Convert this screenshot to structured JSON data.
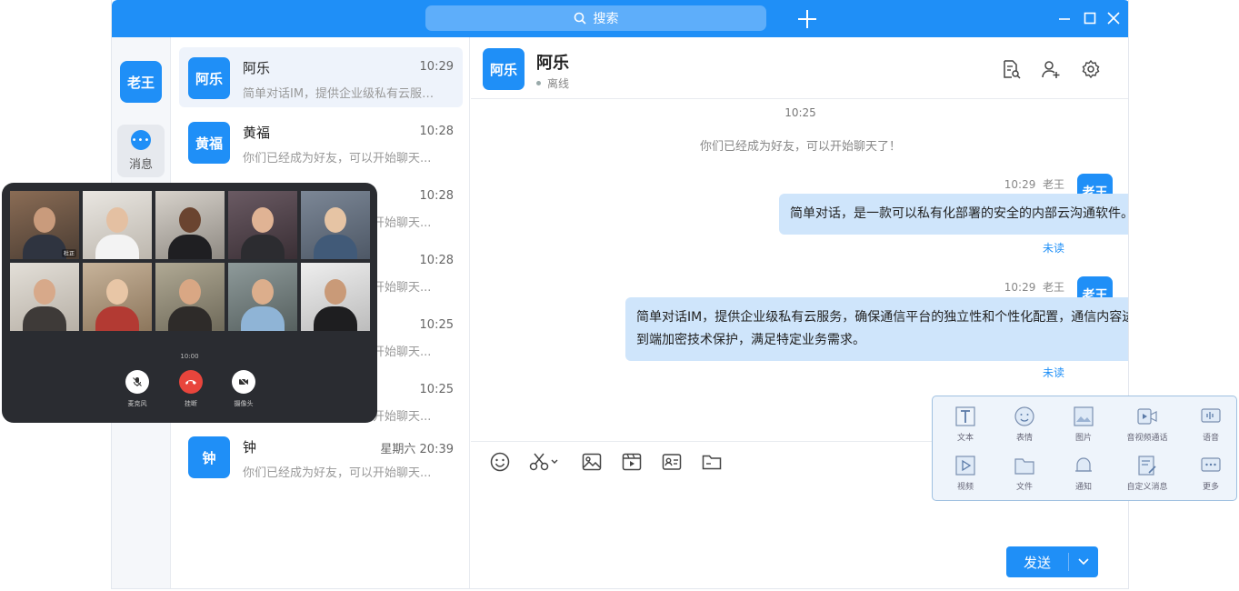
{
  "titlebar": {
    "search_placeholder": "搜索"
  },
  "rail": {
    "avatar": "老王",
    "messages_label": "消息"
  },
  "conversations": [
    {
      "avatar": "阿乐",
      "name": "阿乐",
      "time": "10:29",
      "preview": "简单对话IM，提供企业级私有云服务...",
      "active": true
    },
    {
      "avatar": "黄福",
      "name": "黄福",
      "time": "10:28",
      "preview": "你们已经成为好友，可以开始聊天..."
    },
    {
      "avatar": "",
      "name": "",
      "time": "10:28",
      "preview": "你们已经成为好友，可以开始聊天..."
    },
    {
      "avatar": "",
      "name": "",
      "time": "10:28",
      "preview": "你们已经成为好友，可以开始聊天..."
    },
    {
      "avatar": "",
      "name": "",
      "time": "10:25",
      "preview": "你们已经成为好友，可以开始聊天..."
    },
    {
      "avatar": "",
      "name": "",
      "time": "10:25",
      "preview": "你们已经成为好友，可以开始聊天..."
    },
    {
      "avatar": "钟",
      "name": "钟",
      "time": "星期六 20:39",
      "preview": "你们已经成为好友，可以开始聊天..."
    }
  ],
  "chat": {
    "avatar": "阿乐",
    "name": "阿乐",
    "status": "离线",
    "time_divider": "10:25",
    "system_message": "你们已经成为好友，可以开始聊天了！",
    "messages": [
      {
        "time": "10:29",
        "sender": "老王",
        "avatar": "老王",
        "text": "简单对话，是一款可以私有化部署的安全的内部云沟通软件。",
        "status": "未读"
      },
      {
        "time": "10:29",
        "sender": "老王",
        "avatar": "老王",
        "text": "简单对话IM，提供企业级私有云服务，确保通信平台的独立性和个性化配置，通信内容进行端到端加密技术保护，满足特定业务需求。",
        "status": "未读"
      }
    ],
    "send_label": "发送"
  },
  "panel": {
    "items": [
      "文本",
      "表情",
      "图片",
      "音视频通话",
      "语音",
      "视频",
      "文件",
      "通知",
      "自定义消息",
      "更多"
    ]
  },
  "video_call": {
    "participants": [
      "杜正",
      "",
      "",
      "",
      "",
      "",
      "",
      "",
      "",
      ""
    ],
    "timer": "10:00",
    "mic_label": "麦克风",
    "hangup_label": "挂断",
    "camera_label": "摄像头"
  },
  "colors": {
    "brand": "#1f8ff7",
    "bubble": "#cfe5fb",
    "hangup": "#e8453c"
  }
}
